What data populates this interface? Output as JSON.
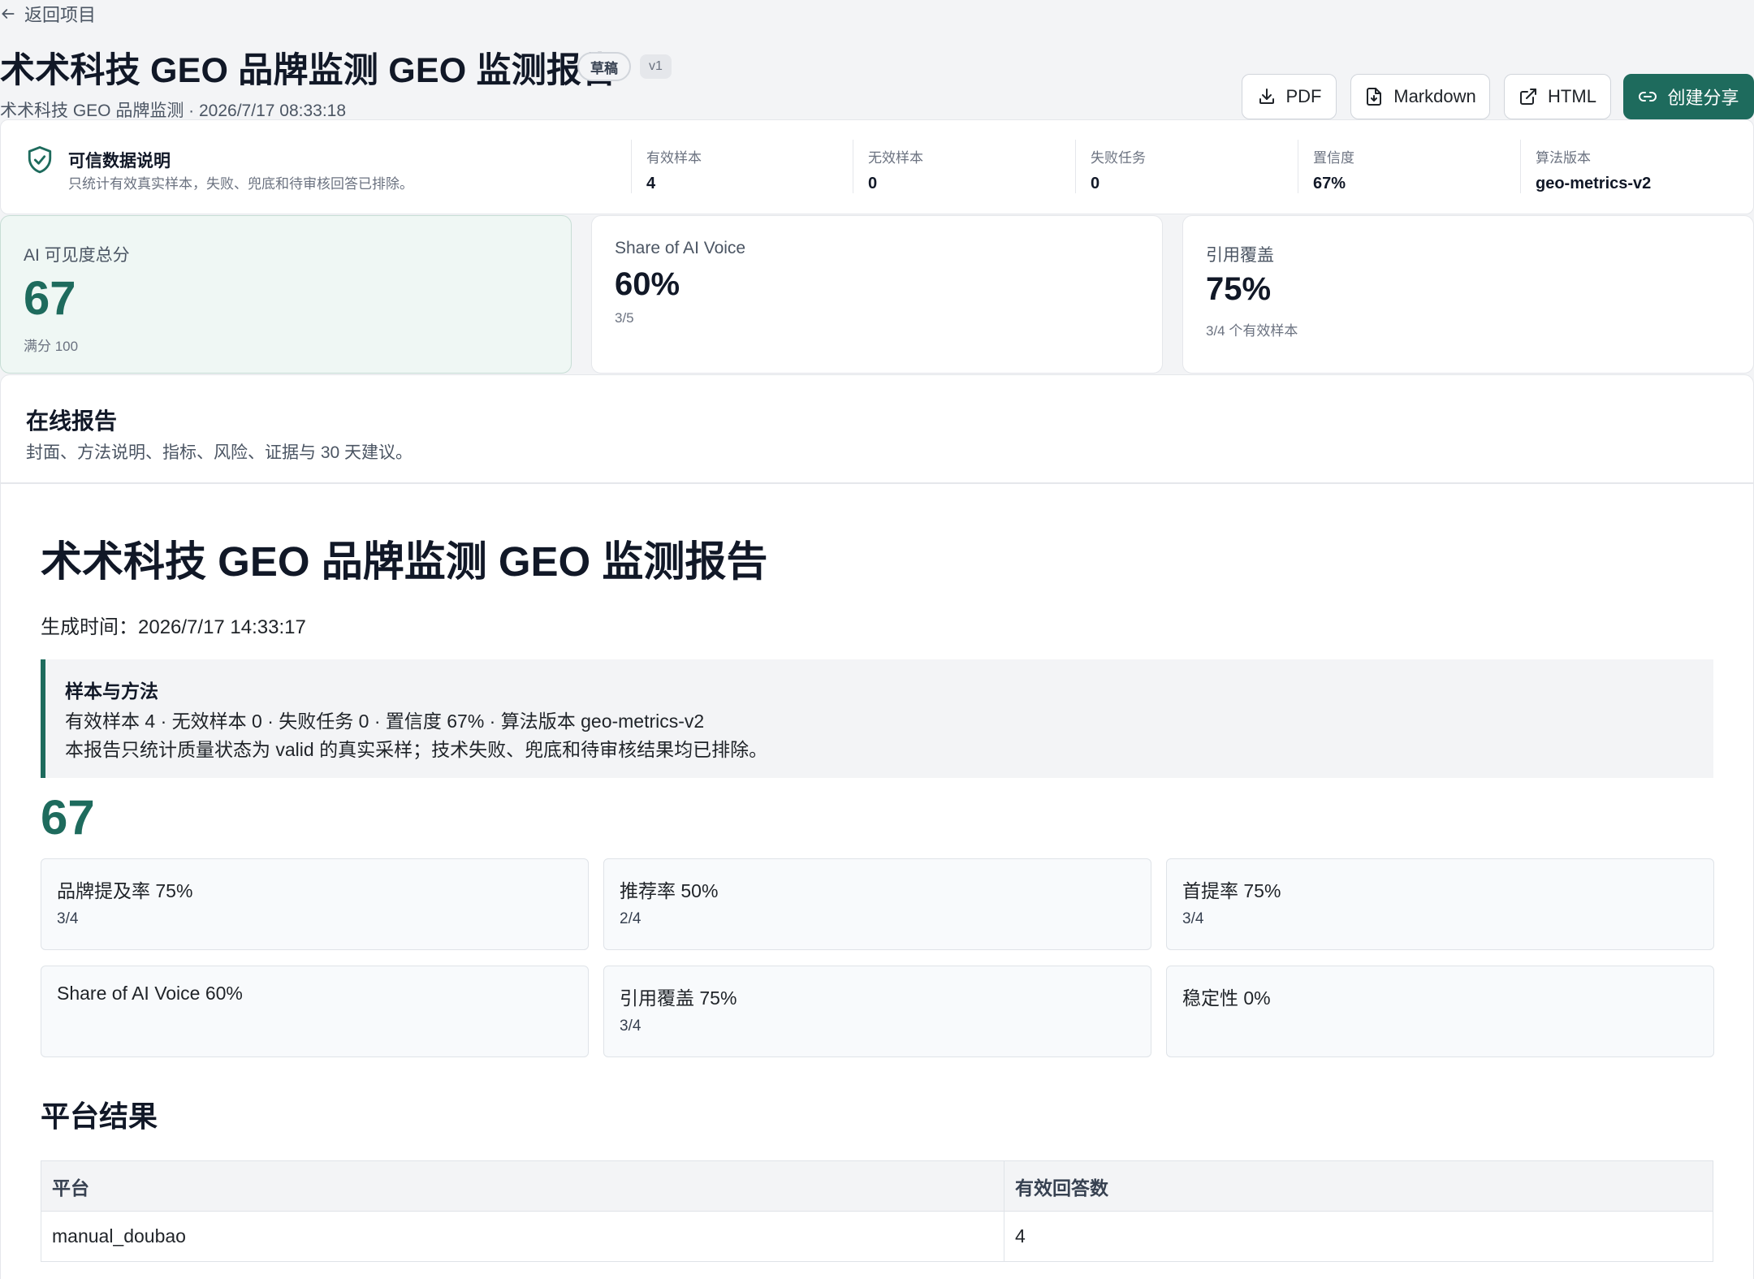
{
  "header": {
    "back_label": "返回项目",
    "title": "术术科技 GEO 品牌监测 GEO 监测报告",
    "status_badge": "草稿",
    "version_badge": "v1",
    "subtitle": "术术科技 GEO 品牌监测 · 2026/7/17 08:33:18",
    "actions": {
      "pdf": "PDF",
      "markdown": "Markdown",
      "html": "HTML",
      "share": "创建分享"
    }
  },
  "trust": {
    "title": "可信数据说明",
    "description": "只统计有效真实样本，失败、兜底和待审核回答已排除。",
    "stats": [
      {
        "label": "有效样本",
        "value": "4"
      },
      {
        "label": "无效样本",
        "value": "0"
      },
      {
        "label": "失败任务",
        "value": "0"
      },
      {
        "label": "置信度",
        "value": "67%"
      },
      {
        "label": "算法版本",
        "value": "geo-metrics-v2"
      }
    ]
  },
  "metrics": [
    {
      "label": "AI 可见度总分",
      "value": "67",
      "sub": "满分 100"
    },
    {
      "label": "Share of AI Voice",
      "value": "60%",
      "sub": "3/5"
    },
    {
      "label": "引用覆盖",
      "value": "75%",
      "sub": "3/4 个有效样本"
    }
  ],
  "online_report": {
    "title": "在线报告",
    "description": "封面、方法说明、指标、风险、证据与 30 天建议。"
  },
  "report": {
    "title": "术术科技 GEO 品牌监测 GEO 监测报告",
    "generated_at": "生成时间：2026/7/17 14:33:17",
    "method": {
      "title": "样本与方法",
      "line1": "有效样本 4 · 无效样本 0 · 失败任务 0 · 置信度 67% · 算法版本 geo-metrics-v2",
      "line2": "本报告只统计质量状态为 valid 的真实采样；技术失败、兜底和待审核结果均已排除。"
    },
    "score": "67",
    "kpis": [
      {
        "label": "品牌提及率 75%",
        "sub": "3/4"
      },
      {
        "label": "推荐率 50%",
        "sub": "2/4"
      },
      {
        "label": "首提率 75%",
        "sub": "3/4"
      },
      {
        "label": "Share of AI Voice 60%",
        "sub": ""
      },
      {
        "label": "引用覆盖 75%",
        "sub": "3/4"
      },
      {
        "label": "稳定性 0%",
        "sub": ""
      }
    ],
    "platform_section": {
      "title": "平台结果",
      "columns": [
        "平台",
        "有效回答数"
      ],
      "rows": [
        [
          "manual_doubao",
          "4"
        ]
      ]
    }
  },
  "colors": {
    "accent": "#1e6b5d",
    "primary_card_bg": "#eff7f4"
  }
}
